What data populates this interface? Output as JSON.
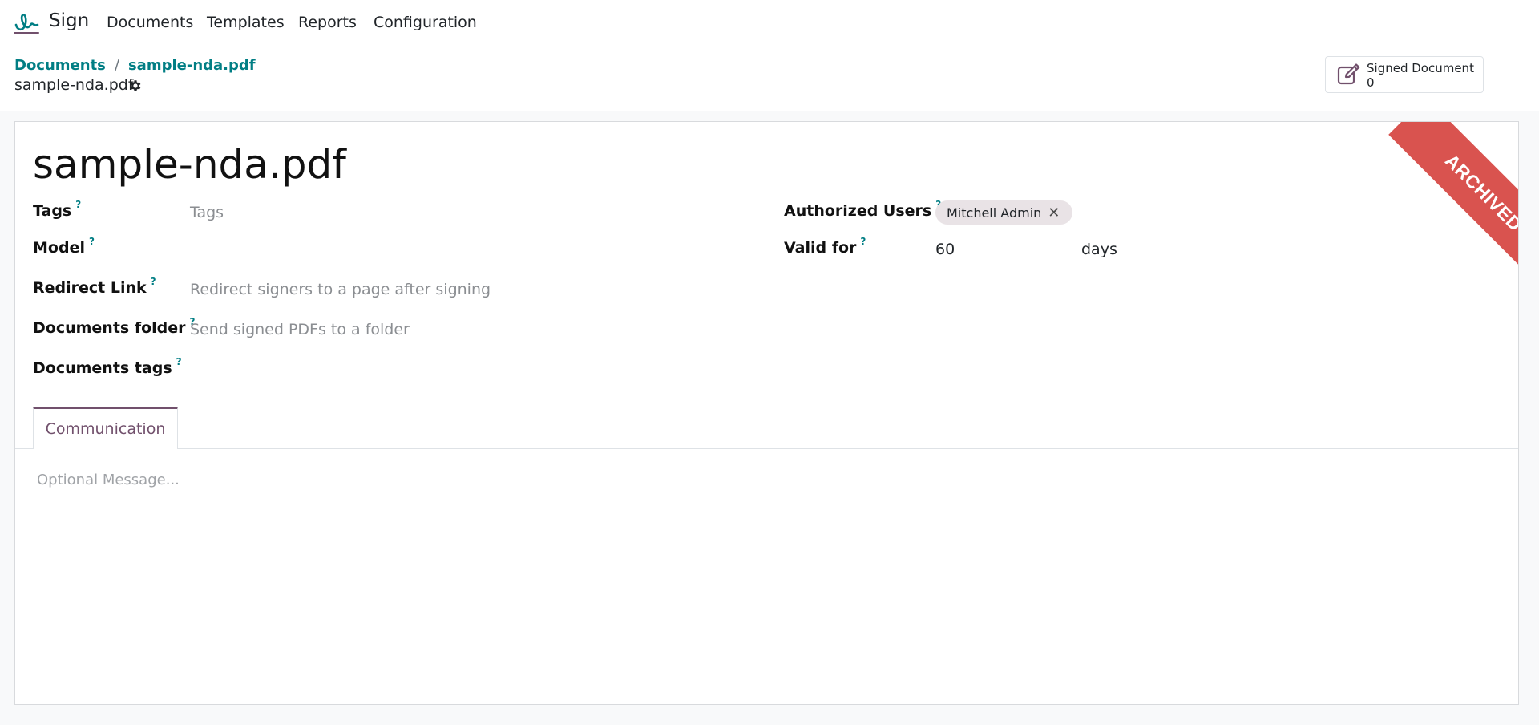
{
  "navbar": {
    "app_name": "Sign",
    "menu": [
      "Documents",
      "Templates",
      "Reports",
      "Configuration"
    ]
  },
  "breadcrumb": {
    "parent": "Documents",
    "separator": "/",
    "current": "sample-nda.pdf"
  },
  "record": {
    "name": "sample-nda.pdf"
  },
  "stat_button": {
    "label": "Signed Document",
    "value": "0"
  },
  "form": {
    "title": "sample-nda.pdf",
    "ribbon": "ARCHIVED",
    "help_mark": "?",
    "fields": {
      "tags": {
        "label": "Tags",
        "placeholder": "Tags"
      },
      "model": {
        "label": "Model",
        "value": ""
      },
      "redirect_link": {
        "label": "Redirect Link",
        "placeholder": "Redirect signers to a page after signing"
      },
      "documents_folder": {
        "label": "Documents folder",
        "placeholder": "Send signed PDFs to a folder"
      },
      "documents_tags": {
        "label": "Documents tags",
        "value": ""
      },
      "authorized_users": {
        "label": "Authorized Users",
        "tags": [
          "Mitchell Admin"
        ],
        "remove_glyph": "✕"
      },
      "valid_for": {
        "label": "Valid for",
        "value": "60",
        "unit": "days"
      }
    }
  },
  "notebook": {
    "tabs": [
      "Communication"
    ],
    "active_tab": "Communication",
    "message_placeholder": "Optional Message..."
  },
  "colors": {
    "brand_teal": "#017e84",
    "accent_purple": "#71506c",
    "ribbon_red": "#d9534f",
    "tag_bg": "#e9e3e6"
  }
}
